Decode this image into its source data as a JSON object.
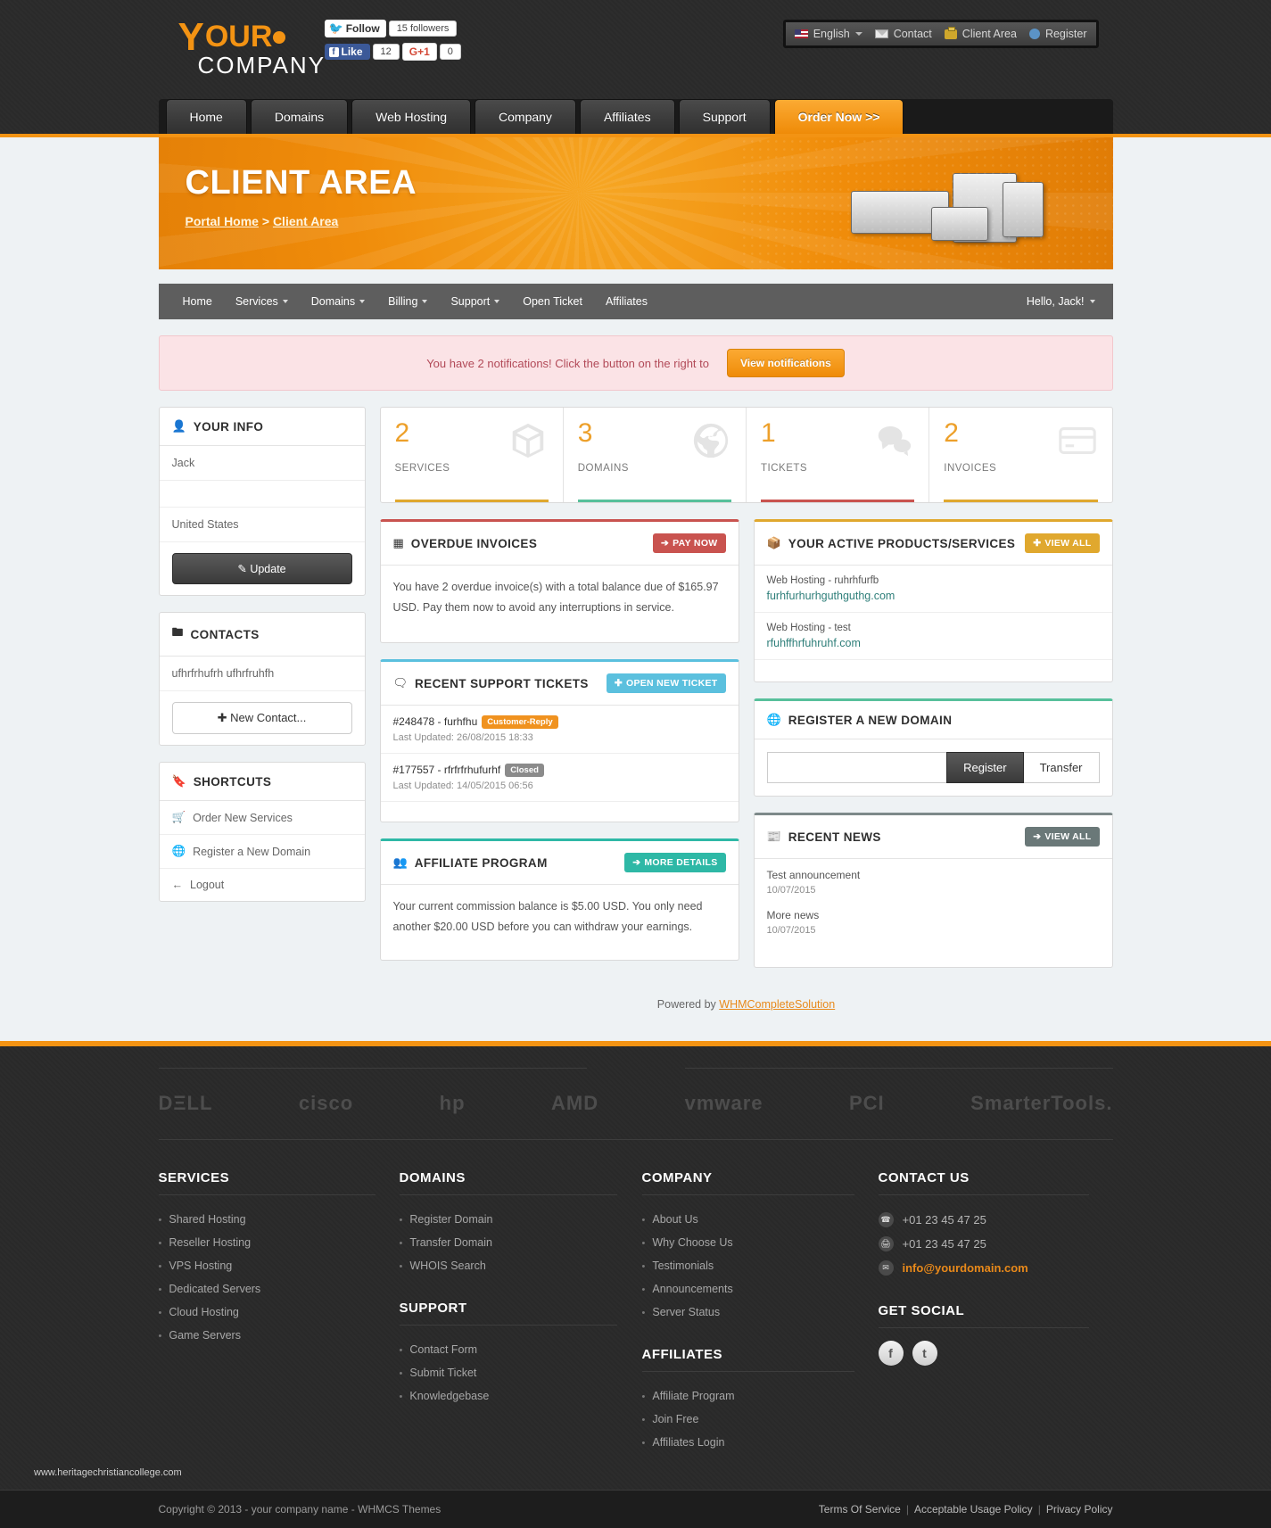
{
  "header": {
    "logo": {
      "y": "Y",
      "our": "OUR",
      "company": "COMPANY"
    },
    "social": {
      "twitter_follow": "Follow",
      "twitter_followers": "15 followers",
      "facebook_like": "Like",
      "facebook_count": "12",
      "gplus": "G+1",
      "gplus_count": "0"
    },
    "utility_nav": [
      {
        "label": "English",
        "icon": "flag-icon",
        "caret": true
      },
      {
        "label": "Contact",
        "icon": "envelope-icon"
      },
      {
        "label": "Client Area",
        "icon": "briefcase-icon"
      },
      {
        "label": "Register",
        "icon": "user-icon"
      }
    ],
    "main_nav": [
      {
        "label": "Home",
        "active": false
      },
      {
        "label": "Domains",
        "active": false
      },
      {
        "label": "Web Hosting",
        "active": false
      },
      {
        "label": "Company",
        "active": false
      },
      {
        "label": "Affiliates",
        "active": false
      },
      {
        "label": "Support",
        "active": false
      },
      {
        "label": "Order Now >>",
        "active": true
      }
    ]
  },
  "banner": {
    "title": "CLIENT AREA",
    "crumb_home": "Portal Home",
    "crumb_sep": " > ",
    "crumb_current": "Client Area"
  },
  "client_nav": {
    "items": [
      {
        "label": "Home",
        "caret": false
      },
      {
        "label": "Services",
        "caret": true
      },
      {
        "label": "Domains",
        "caret": true
      },
      {
        "label": "Billing",
        "caret": true
      },
      {
        "label": "Support",
        "caret": true
      },
      {
        "label": "Open Ticket",
        "caret": false
      },
      {
        "label": "Affiliates",
        "caret": false
      }
    ],
    "greeting": "Hello, Jack!"
  },
  "alert": {
    "text": "You have 2 notifications! Click the button on the right to",
    "button": "View notifications"
  },
  "your_info": {
    "title": "YOUR INFO",
    "name": "Jack",
    "country": "United States",
    "update_button": "Update"
  },
  "contacts": {
    "title": "CONTACTS",
    "entry": "ufhrfrhufrh ufhrfruhfh",
    "new_button": "New Contact..."
  },
  "shortcuts": {
    "title": "SHORTCUTS",
    "items": [
      {
        "label": "Order New Services",
        "icon": "cart-icon"
      },
      {
        "label": "Register a New Domain",
        "icon": "globe-icon"
      },
      {
        "label": "Logout",
        "icon": "logout-icon"
      }
    ]
  },
  "stats": [
    {
      "value": "2",
      "label": "SERVICES",
      "icon": "box-icon",
      "color": "#e0a82e"
    },
    {
      "value": "3",
      "label": "DOMAINS",
      "icon": "globe-icon",
      "color": "#57c09b"
    },
    {
      "value": "1",
      "label": "TICKETS",
      "icon": "chat-icon",
      "color": "#c9534f"
    },
    {
      "value": "2",
      "label": "INVOICES",
      "icon": "card-icon",
      "color": "#e0a82e"
    }
  ],
  "overdue": {
    "title": "OVERDUE INVOICES",
    "button": "PAY NOW",
    "text": "You have 2 overdue invoice(s) with a total balance due of $165.97 USD. Pay them now to avoid any interruptions in service."
  },
  "tickets": {
    "title": "RECENT SUPPORT TICKETS",
    "button": "OPEN NEW TICKET",
    "items": [
      {
        "subject": "#248478 - furhfhu",
        "status": "Customer-Reply",
        "status_style": "orange",
        "updated": "Last Updated: 26/08/2015 18:33"
      },
      {
        "subject": "#177557 - rfrfrfrhufurhf",
        "status": "Closed",
        "status_style": "grey",
        "updated": "Last Updated: 14/05/2015 06:56"
      }
    ]
  },
  "affiliate": {
    "title": "AFFILIATE PROGRAM",
    "button": "MORE DETAILS",
    "text": "Your current commission balance is $5.00 USD. You only need another $20.00 USD before you can withdraw your earnings."
  },
  "products": {
    "title": "YOUR ACTIVE PRODUCTS/SERVICES",
    "button": "VIEW ALL",
    "items": [
      {
        "name": "Web Hosting - ruhrhfurfb",
        "domain": "furhfurhurhguthguthg.com"
      },
      {
        "name": "Web Hosting - test",
        "domain": "rfuhffhrfuhruhf.com"
      }
    ]
  },
  "register_domain": {
    "title": "REGISTER A NEW DOMAIN",
    "input_value": "",
    "input_placeholder": "",
    "register_button": "Register",
    "transfer_button": "Transfer"
  },
  "news": {
    "title": "RECENT NEWS",
    "button": "VIEW ALL",
    "items": [
      {
        "title": "Test announcement",
        "date": "10/07/2015"
      },
      {
        "title": "More news",
        "date": "10/07/2015"
      }
    ]
  },
  "powered": {
    "prefix": "Powered by ",
    "link": "WHMCompleteSolution"
  },
  "footer": {
    "brands": [
      "DΞLL",
      "cisco",
      "hp",
      "AMD",
      "vmware",
      "PCI",
      "SmarterTools."
    ],
    "columns": [
      {
        "heading": "SERVICES",
        "items": [
          "Shared Hosting",
          "Reseller Hosting",
          "VPS Hosting",
          "Dedicated Servers",
          "Cloud Hosting",
          "Game Servers"
        ]
      },
      {
        "heading": "DOMAINS",
        "items": [
          "Register Domain",
          "Transfer Domain",
          "WHOIS Search"
        ],
        "heading2": "SUPPORT",
        "items2": [
          "Contact Form",
          "Submit Ticket",
          "Knowledgebase"
        ]
      },
      {
        "heading": "COMPANY",
        "items": [
          "About Us",
          "Why Choose Us",
          "Testimonials",
          "Announcements",
          "Server Status"
        ],
        "heading2": "AFFILIATES",
        "items2": [
          "Affiliate Program",
          "Join Free",
          "Affiliates Login"
        ]
      }
    ],
    "contact": {
      "heading": "CONTACT US",
      "phone": "+01 23 45 47 25",
      "fax": "+01 23 45 47 25",
      "email": "info@yourdomain.com",
      "social_heading": "GET SOCIAL",
      "social": [
        "f",
        "t"
      ]
    },
    "watermark": "www.heritagechristiancollege.com",
    "copyright": "Copyright © 2013 - your company name - WHMCS Themes",
    "legal": [
      "Terms Of Service",
      "Acceptable Usage Policy",
      "Privacy Policy"
    ]
  }
}
